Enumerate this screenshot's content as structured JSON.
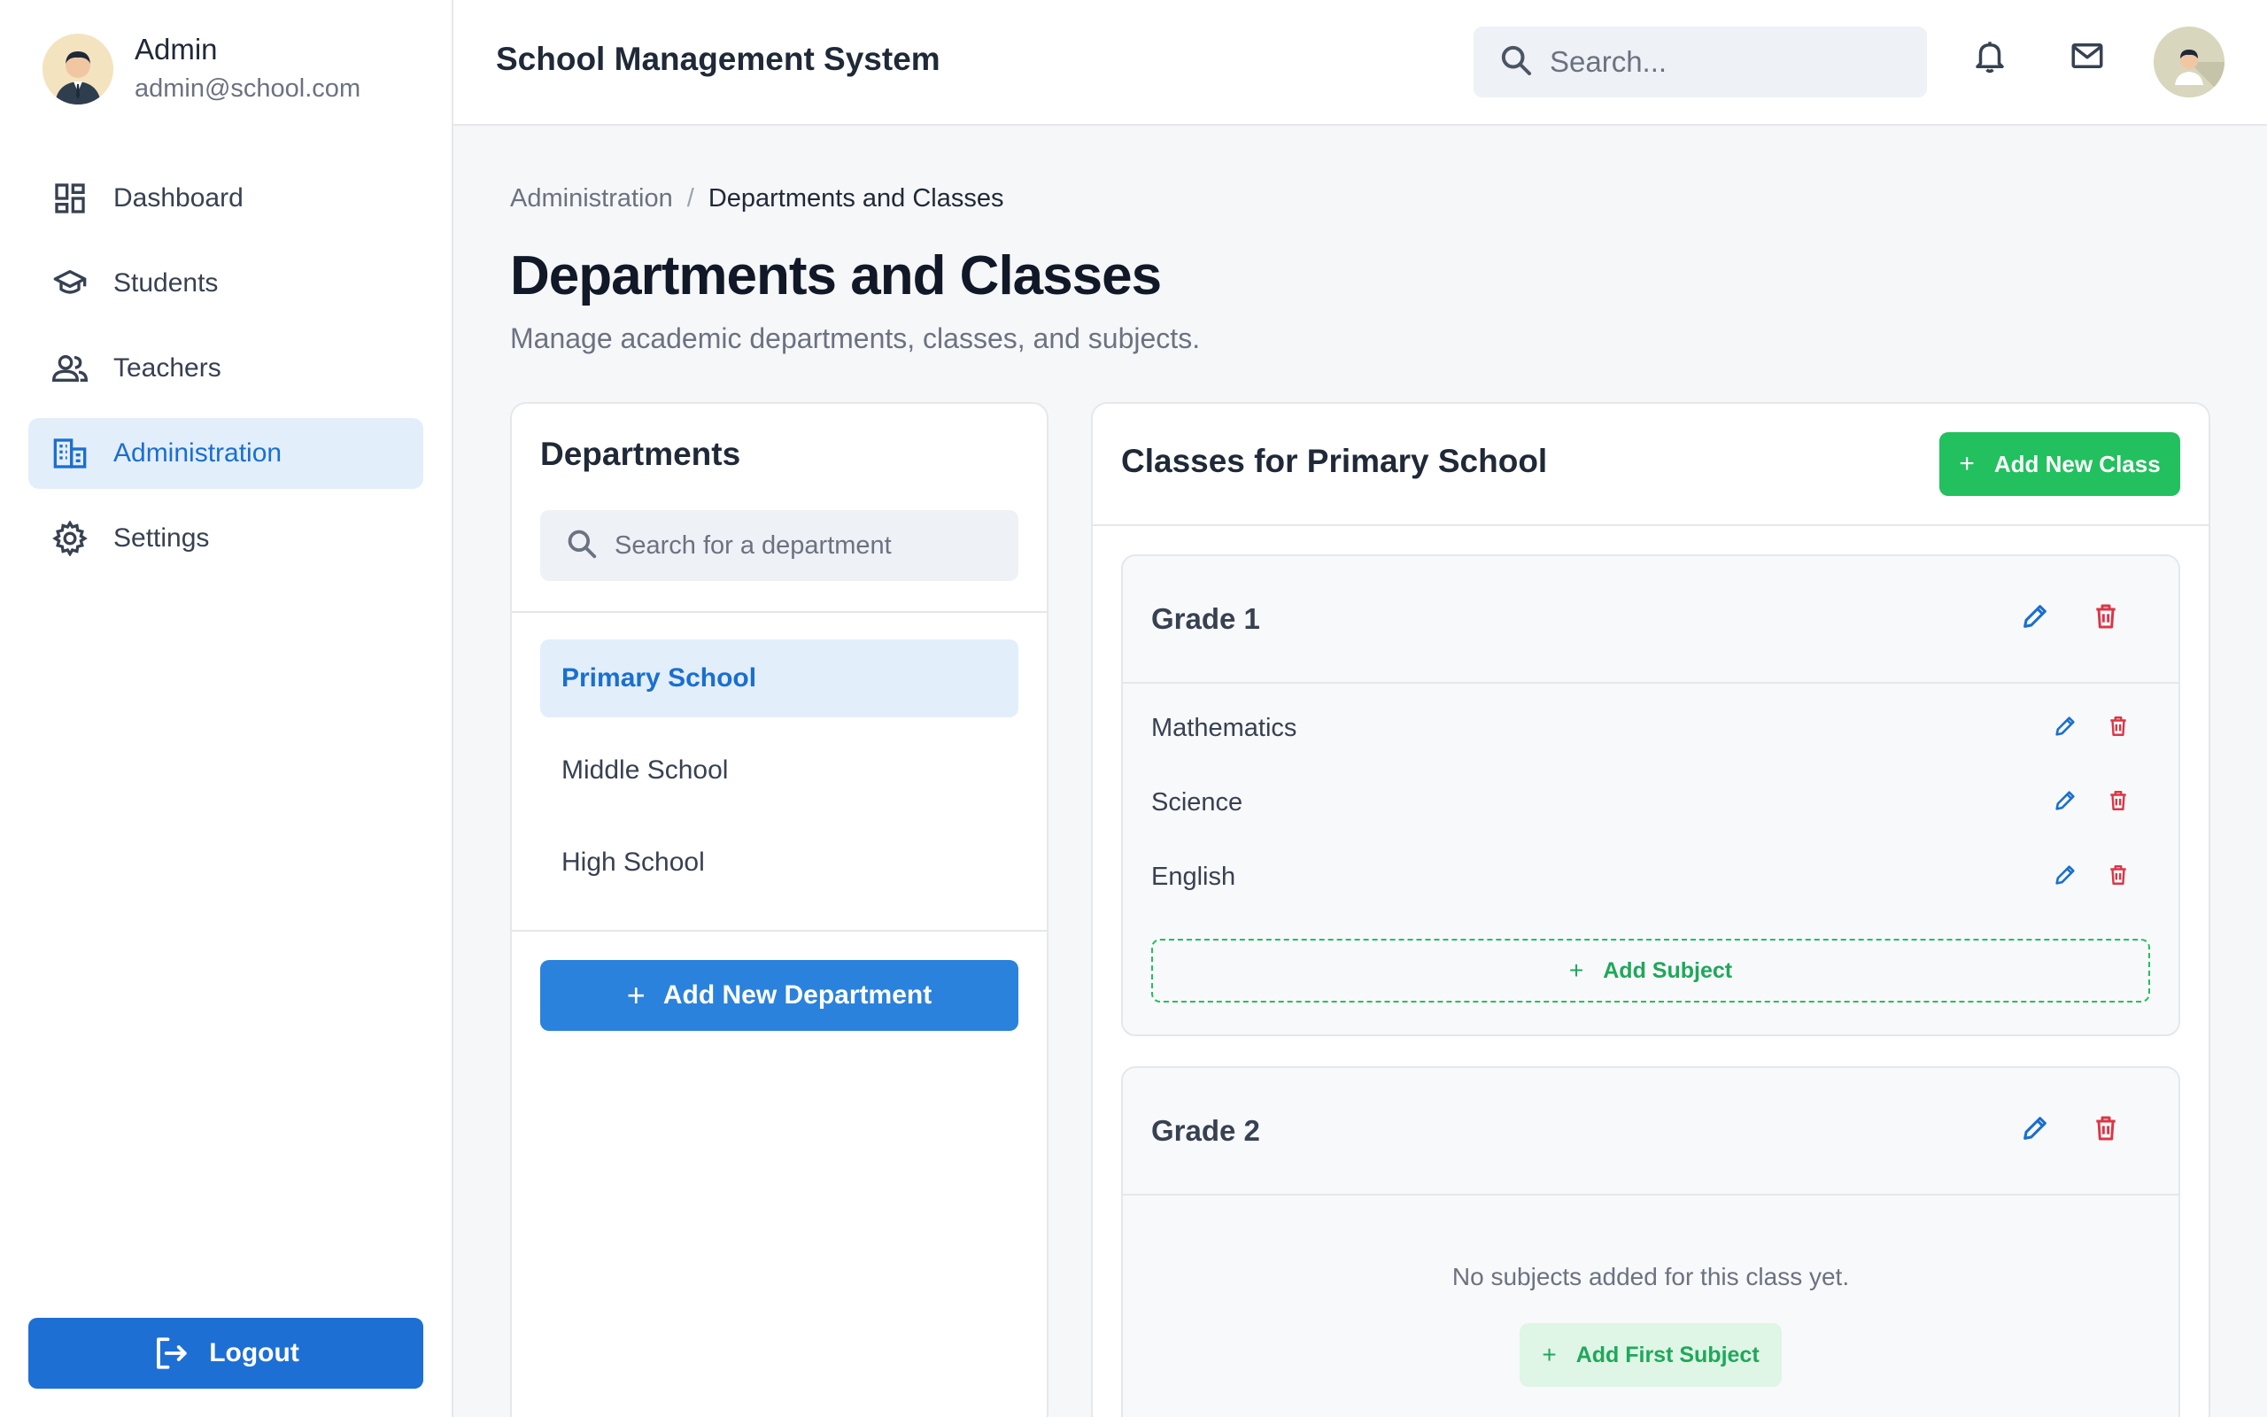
{
  "user": {
    "name": "Admin",
    "email": "admin@school.com"
  },
  "sidebar": {
    "items": [
      {
        "label": "Dashboard",
        "icon": "dashboard-icon",
        "active": false
      },
      {
        "label": "Students",
        "icon": "graduation-cap-icon",
        "active": false
      },
      {
        "label": "Teachers",
        "icon": "people-icon",
        "active": false
      },
      {
        "label": "Administration",
        "icon": "building-icon",
        "active": true
      },
      {
        "label": "Settings",
        "icon": "gear-icon",
        "active": false
      }
    ],
    "logout_label": "Logout"
  },
  "header": {
    "title": "School Management System",
    "search_placeholder": "Search..."
  },
  "breadcrumb": {
    "parent": "Administration",
    "separator": "/",
    "current": "Departments and Classes"
  },
  "page": {
    "title": "Departments and Classes",
    "subtitle": "Manage academic departments, classes, and subjects."
  },
  "departments": {
    "title": "Departments",
    "search_placeholder": "Search for a department",
    "items": [
      {
        "label": "Primary School",
        "active": true
      },
      {
        "label": "Middle School",
        "active": false
      },
      {
        "label": "High School",
        "active": false
      }
    ],
    "add_label": "Add New Department"
  },
  "classes": {
    "title": "Classes for Primary School",
    "add_label": "Add New Class",
    "grades": [
      {
        "name": "Grade 1",
        "subjects": [
          "Mathematics",
          "Science",
          "English"
        ],
        "add_subject_label": "Add Subject"
      },
      {
        "name": "Grade 2",
        "subjects": [],
        "empty_text": "No subjects added for this class yet.",
        "add_first_label": "Add First Subject"
      }
    ]
  },
  "colors": {
    "primary": "#1d6fd4",
    "success": "#22c05e",
    "danger": "#dc3545",
    "active_bg": "#e3eefb"
  }
}
